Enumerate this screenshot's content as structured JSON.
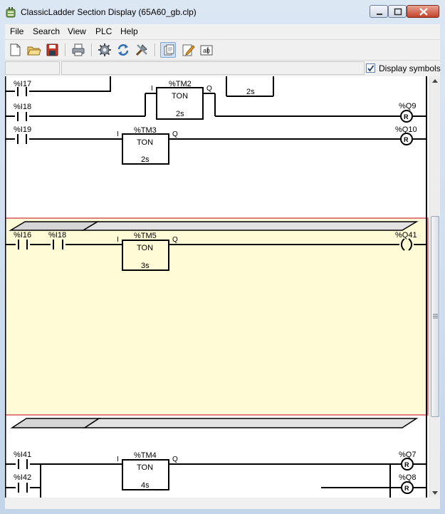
{
  "window": {
    "title": "ClassicLadder Section Display (65A60_gb.clp)"
  },
  "menu": {
    "file": "File",
    "search": "Search",
    "view": "View",
    "plc": "PLC",
    "help": "Help"
  },
  "toolbar": {
    "icons": [
      "new-icon",
      "open-icon",
      "save-icon",
      "print-icon",
      "config-icon",
      "refresh-icon",
      "tools-icon",
      "symbols-view-icon",
      "edit-icon",
      "rename-icon"
    ]
  },
  "options": {
    "display_symbols_label": "Display symbols",
    "display_symbols_checked": true
  },
  "rungs": [
    {
      "contacts": [
        "%I17",
        "%I18",
        "%I19"
      ],
      "timers": [
        {
          "id": "%TM2",
          "type": "TON",
          "preset": "2s",
          "input": "I",
          "output": "Q"
        },
        {
          "id": "%TM3",
          "type": "TON",
          "preset": "2s",
          "input": "I",
          "output": "Q"
        }
      ],
      "partial_block_preset": "2s",
      "coils": [
        "%Q9",
        "%Q10"
      ],
      "coil_marks": [
        "R",
        "R"
      ]
    },
    {
      "selected": true,
      "contacts": [
        "%I16",
        "%I18"
      ],
      "timers": [
        {
          "id": "%TM5",
          "type": "TON",
          "preset": "3s",
          "input": "I",
          "output": "Q"
        }
      ],
      "coils": [
        "%Q41"
      ]
    },
    {
      "contacts": [
        "%I41",
        "%I42"
      ],
      "timers": [
        {
          "id": "%TM4",
          "type": "TON",
          "preset": "4s",
          "input": "I",
          "output": "Q"
        }
      ],
      "coils": [
        "%Q7",
        "%Q8"
      ],
      "coil_marks": [
        "R",
        "R"
      ]
    }
  ],
  "colors": {
    "selected_rung_bg": "#fffbd6",
    "selected_rung_border": "#e08080",
    "titlebar": "#c9d9ee"
  }
}
